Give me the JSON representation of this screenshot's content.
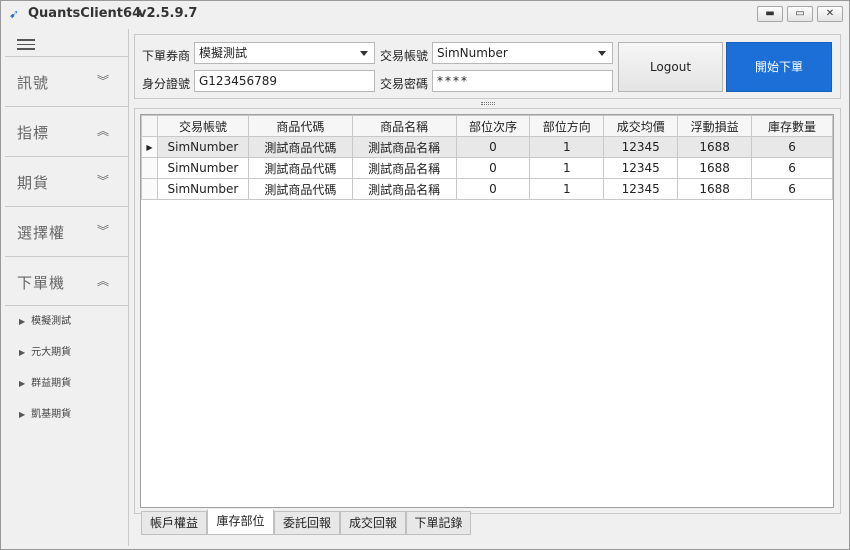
{
  "app": {
    "title": "QuantsClient64",
    "version": "v2.5.9.7",
    "window_controls": {
      "minimize": "▬",
      "maximize": "▭",
      "close": "✕"
    }
  },
  "sidebar": {
    "sections": [
      {
        "label": "訊號",
        "chevron": "down"
      },
      {
        "label": "指標",
        "chevron": "up"
      },
      {
        "label": "期貨",
        "chevron": "down"
      },
      {
        "label": "選擇權",
        "chevron": "down"
      },
      {
        "label": "下單機",
        "chevron": "up"
      }
    ],
    "sub_items": [
      "模擬測試",
      "元大期貨",
      "群益期貨",
      "凱基期貨"
    ]
  },
  "form": {
    "broker_label": "下單券商",
    "broker_value": "模擬測試",
    "account_label": "交易帳號",
    "account_value": "SimNumber",
    "id_label": "身分證號",
    "id_value": "G123456789",
    "password_label": "交易密碼",
    "password_value": "****",
    "logout_label": "Logout",
    "start_order_label": "開始下單"
  },
  "grid": {
    "columns": [
      "交易帳號",
      "商品代碼",
      "商品名稱",
      "部位次序",
      "部位方向",
      "成交均價",
      "浮動損益",
      "庫存數量"
    ],
    "rows": [
      [
        "SimNumber",
        "測試商品代碼",
        "測試商品名稱",
        "0",
        "1",
        "12345",
        "1688",
        "6"
      ],
      [
        "SimNumber",
        "測試商品代碼",
        "測試商品名稱",
        "0",
        "1",
        "12345",
        "1688",
        "6"
      ],
      [
        "SimNumber",
        "測試商品代碼",
        "測試商品名稱",
        "0",
        "1",
        "12345",
        "1688",
        "6"
      ]
    ],
    "selected_row_marker": "▶"
  },
  "tabs": [
    "帳戶權益",
    "庫存部位",
    "委託回報",
    "成交回報",
    "下單記錄"
  ],
  "active_tab": "庫存部位",
  "colors": {
    "accent": "#1b6fd6"
  }
}
